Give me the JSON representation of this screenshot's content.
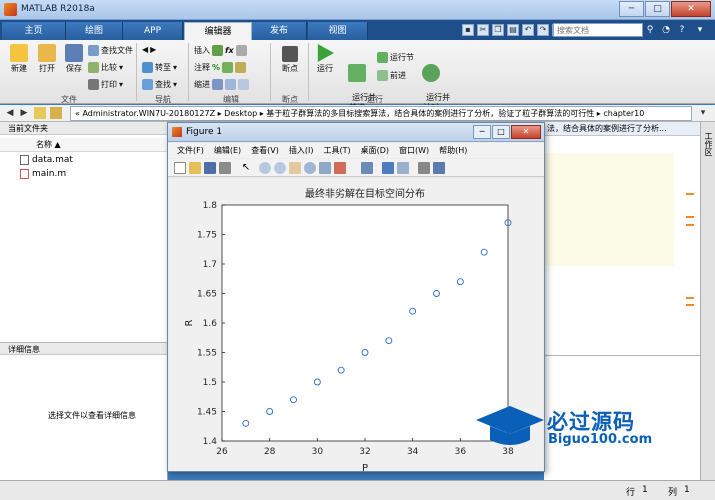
{
  "window": {
    "title": "MATLAB R2018a",
    "controls": [
      "─",
      "□",
      "✕"
    ]
  },
  "tabs": [
    {
      "label": "主页"
    },
    {
      "label": "绘图"
    },
    {
      "label": "APP"
    },
    {
      "label": "编辑器"
    },
    {
      "label": "发布"
    },
    {
      "label": "视图"
    }
  ],
  "search": {
    "placeholder": "搜索文档"
  },
  "ribbon": {
    "new_label": "新建",
    "open_label": "打开",
    "save_label": "保存",
    "find_files": "查找文件",
    "compare": "比较",
    "print": "打印",
    "goto": "转至",
    "find": "查找",
    "insert": "插入",
    "comment": "注释",
    "indent": "缩进",
    "breakpoints": "断点",
    "run": "运行",
    "run_advance": "运行并\n前进",
    "run_section": "运行节",
    "advance": "前进",
    "run_time": "运行并\n计时",
    "groups": [
      "文件",
      "导航",
      "编辑",
      "断点",
      "运行"
    ]
  },
  "address": {
    "path": "« Administrator.WIN7U-20180127Z ▸ Desktop ▸ 基于粒子群算法的多目标搜索算法，结合具体的案例进行了分析，验证了粒子群算法的可行性 ▸ chapter10"
  },
  "left_panel": {
    "title": "当前文件夹",
    "column": "名称 ▲",
    "files": [
      "data.mat",
      "main.m"
    ],
    "detail_title": "详细信息",
    "detail_msg": "选择文件以查看详细信息"
  },
  "editor": {
    "tab_text": "法，结合具体的案例进行了分析..."
  },
  "right_sidebar_label": "工作区",
  "figure": {
    "title": "Figure 1",
    "menu": [
      "文件(F)",
      "编辑(E)",
      "查看(V)",
      "插入(I)",
      "工具(T)",
      "桌面(D)",
      "窗口(W)",
      "帮助(H)"
    ]
  },
  "status": {
    "line_label": "行",
    "line_value": "1",
    "col_label": "列",
    "col_value": "1"
  },
  "watermark": {
    "cn": "必过源码",
    "en": "Biguo100.com"
  },
  "colors": {
    "marker": "#2a6fcf",
    "accent": "#f08a24"
  },
  "chart_data": {
    "type": "scatter",
    "title": "最终非劣解在目标空间分布",
    "xlabel": "P",
    "ylabel": "R",
    "xlim": [
      26,
      38
    ],
    "ylim": [
      1.4,
      1.8
    ],
    "xticks": [
      26,
      28,
      30,
      32,
      34,
      36,
      38
    ],
    "yticks": [
      1.4,
      1.45,
      1.5,
      1.55,
      1.6,
      1.65,
      1.7,
      1.75,
      1.8
    ],
    "grid": false,
    "points": [
      {
        "x": 27,
        "y": 1.43
      },
      {
        "x": 28,
        "y": 1.45
      },
      {
        "x": 29,
        "y": 1.47
      },
      {
        "x": 30,
        "y": 1.5
      },
      {
        "x": 31,
        "y": 1.52
      },
      {
        "x": 32,
        "y": 1.55
      },
      {
        "x": 33,
        "y": 1.57
      },
      {
        "x": 34,
        "y": 1.62
      },
      {
        "x": 35,
        "y": 1.65
      },
      {
        "x": 36,
        "y": 1.67
      },
      {
        "x": 37,
        "y": 1.72
      },
      {
        "x": 38,
        "y": 1.77
      }
    ]
  }
}
